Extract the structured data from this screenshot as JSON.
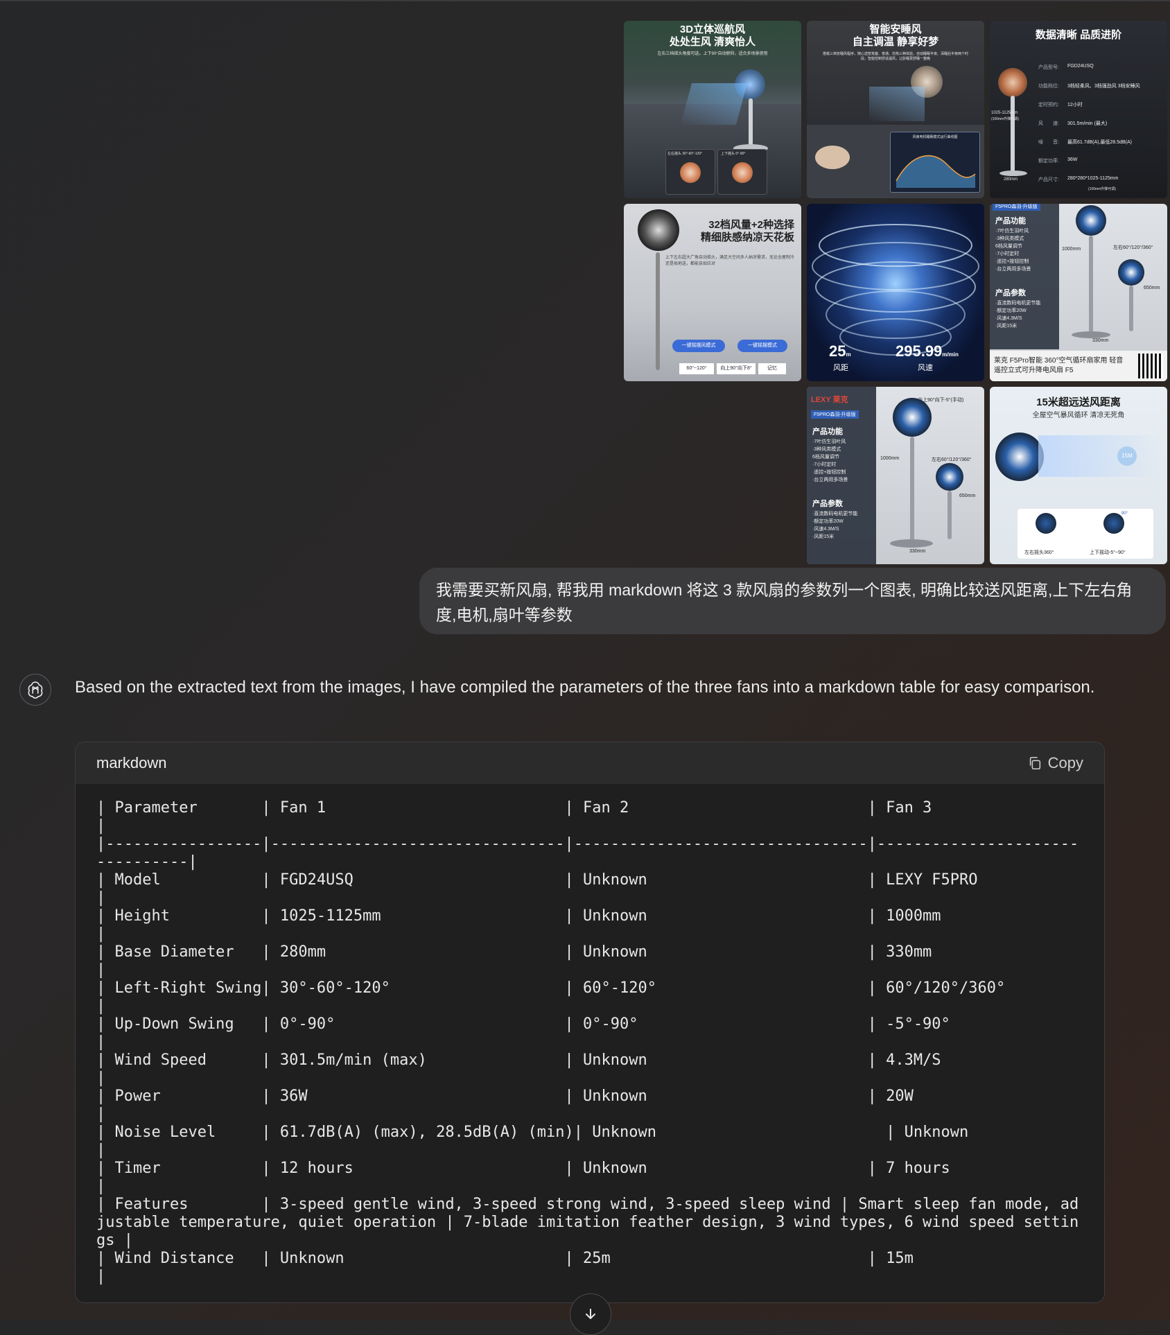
{
  "images": {
    "img1": {
      "title": "3D立体巡航风",
      "subtitle": "处处生风 清爽怡人",
      "desc": "左右三档摇头角度可选，上下90°自动俯仰，适合多场景使用",
      "left_label": "左右摇头 30°-60°-120°",
      "right_label": "上下摇头 0°-90°"
    },
    "img2": {
      "title": "智能安睡风",
      "subtitle": "自主调温 静享好梦",
      "desc": "搭载三档安睡风程序，随心选暂荒塞、普通、仿热三种体验，自动睡眠半夜、深睡后半夜两个时段，智能控制舒适温风，让卧睡更舒睡一整晚",
      "chart_title": "风扇电机睡眠模式运行曲线图"
    },
    "img3": {
      "title": "数据清晰 品质进阶",
      "rows": [
        {
          "k": "产品型号:",
          "v": "FGD24USQ"
        },
        {
          "k": "功能档位:",
          "v": "3档轻柔风、3档强劲风 3档安睡风"
        },
        {
          "k": "定时预约:",
          "v": "12小时"
        },
        {
          "k": "风　　速:",
          "v": "301.5m/min (最大)"
        },
        {
          "k": "噪　　音:",
          "v": "最高61.7dB(A),最低28.5dB(A)"
        },
        {
          "k": "额定功率:",
          "v": "36W"
        },
        {
          "k": "产品尺寸:",
          "v": "280*280*1025-1125mm"
        }
      ],
      "height_label": "1025-1125mm",
      "height_note": "(100mm升降可调)",
      "size_note": "(100mm升降可调)",
      "base_label": "280mm"
    },
    "img4": {
      "title": "32档风量+2种选择",
      "subtitle": "精细肤感纳凉天花板",
      "desc": "上下左右超大广角自动摇头，满足大空间多人纳凉需求，无论全屋制冷还是局地送，都能自如应对",
      "btn1": "一键摇摆风模式",
      "btn2": "一键摇摆模式",
      "chip1": "60°~120°",
      "chip2": "向上90°向下8°",
      "chip3": "记忆"
    },
    "img5": {
      "distance": "25",
      "distance_unit": "m",
      "distance_label": "风距",
      "speed": "295.99",
      "speed_unit": "m/min",
      "speed_label": "风速"
    },
    "img6": {
      "badge": "F5PRO森羽-升级版",
      "features_title": "产品功能",
      "features": [
        "·7叶仿生羽叶风",
        "·3种风类模式",
        "6档风量调节",
        "·7小时定时",
        "·遥控+按钮控制",
        "·台立两用多场景"
      ],
      "params_title": "产品参数",
      "params": [
        "·直流数码电机更节能",
        "·额定功率20W",
        "·风速4.3M/S",
        "·风距15米"
      ],
      "height_label": "1000mm",
      "angle_label": "左右60°/120°/360°",
      "low_label": "650mm",
      "base_label": "330mm",
      "footer": "莱克 F5Pro智能 360°空气循环扇家用 轻音遥控立式可升降电风扇 F5"
    },
    "img7": {
      "brand": "LEXY 莱克",
      "badge": "F5PRO森羽-升级版",
      "top_label": "向上90°向下-5°(手动)",
      "features_title": "产品功能",
      "features": [
        "·7叶仿生羽叶风",
        "·3种风类模式",
        "6档风量调节",
        "·7小时定时",
        "·遥控+按钮控制",
        "·台立两用多场景"
      ],
      "params_title": "产品参数",
      "params": [
        "·直流数码电机更节能",
        "·额定功率20W",
        "·风速4.3M/S",
        "·风距15米"
      ],
      "height_label": "1000mm",
      "angle_label": "左右60°/120°/360°",
      "low_label": "650mm",
      "base_label": "330mm"
    },
    "img8": {
      "title": "15米超远送风距离",
      "subtitle": "全屋空气暴风循环 清凉无死角",
      "badge": "15M",
      "label1": "左右摇头360°",
      "label2": "上下摇动-5°~90°",
      "label3": "90°"
    }
  },
  "user_message": "我需要买新风扇, 帮我用 markdown 将这 3 款风扇的参数列一个图表, 明确比较送风距离,上下左右角度,电机,扇叶等参数",
  "assistant": {
    "intro": "Based on the extracted text from the images, I have compiled the parameters of the three fans into a markdown table for easy comparison.",
    "code_lang": "markdown",
    "copy_label": "Copy",
    "code": "| Parameter       | Fan 1                          | Fan 2                          | Fan 3                          |\n|-----------------|--------------------------------|--------------------------------|--------------------------------|\n| Model           | FGD24USQ                       | Unknown                        | LEXY F5PRO                     |\n| Height          | 1025-1125mm                    | Unknown                        | 1000mm                         |\n| Base Diameter   | 280mm                          | Unknown                        | 330mm                          |\n| Left-Right Swing| 30°-60°-120°                   | 60°-120°                       | 60°/120°/360°                  |\n| Up-Down Swing   | 0°-90°                         | 0°-90°                         | -5°-90°                        |\n| Wind Speed      | 301.5m/min (max)               | Unknown                        | 4.3M/S                         |\n| Power           | 36W                            | Unknown                        | 20W                            |\n| Noise Level     | 61.7dB(A) (max), 28.5dB(A) (min)| Unknown                         | Unknown                        |\n| Timer           | 12 hours                       | Unknown                        | 7 hours                        |\n| Features        | 3-speed gentle wind, 3-speed strong wind, 3-speed sleep wind | Smart sleep fan mode, adjustable temperature, quiet operation | 7-blade imitation feather design, 3 wind types, 6 wind speed settings |\n| Wind Distance   | Unknown                        | 25m                            | 15m                            |"
  }
}
